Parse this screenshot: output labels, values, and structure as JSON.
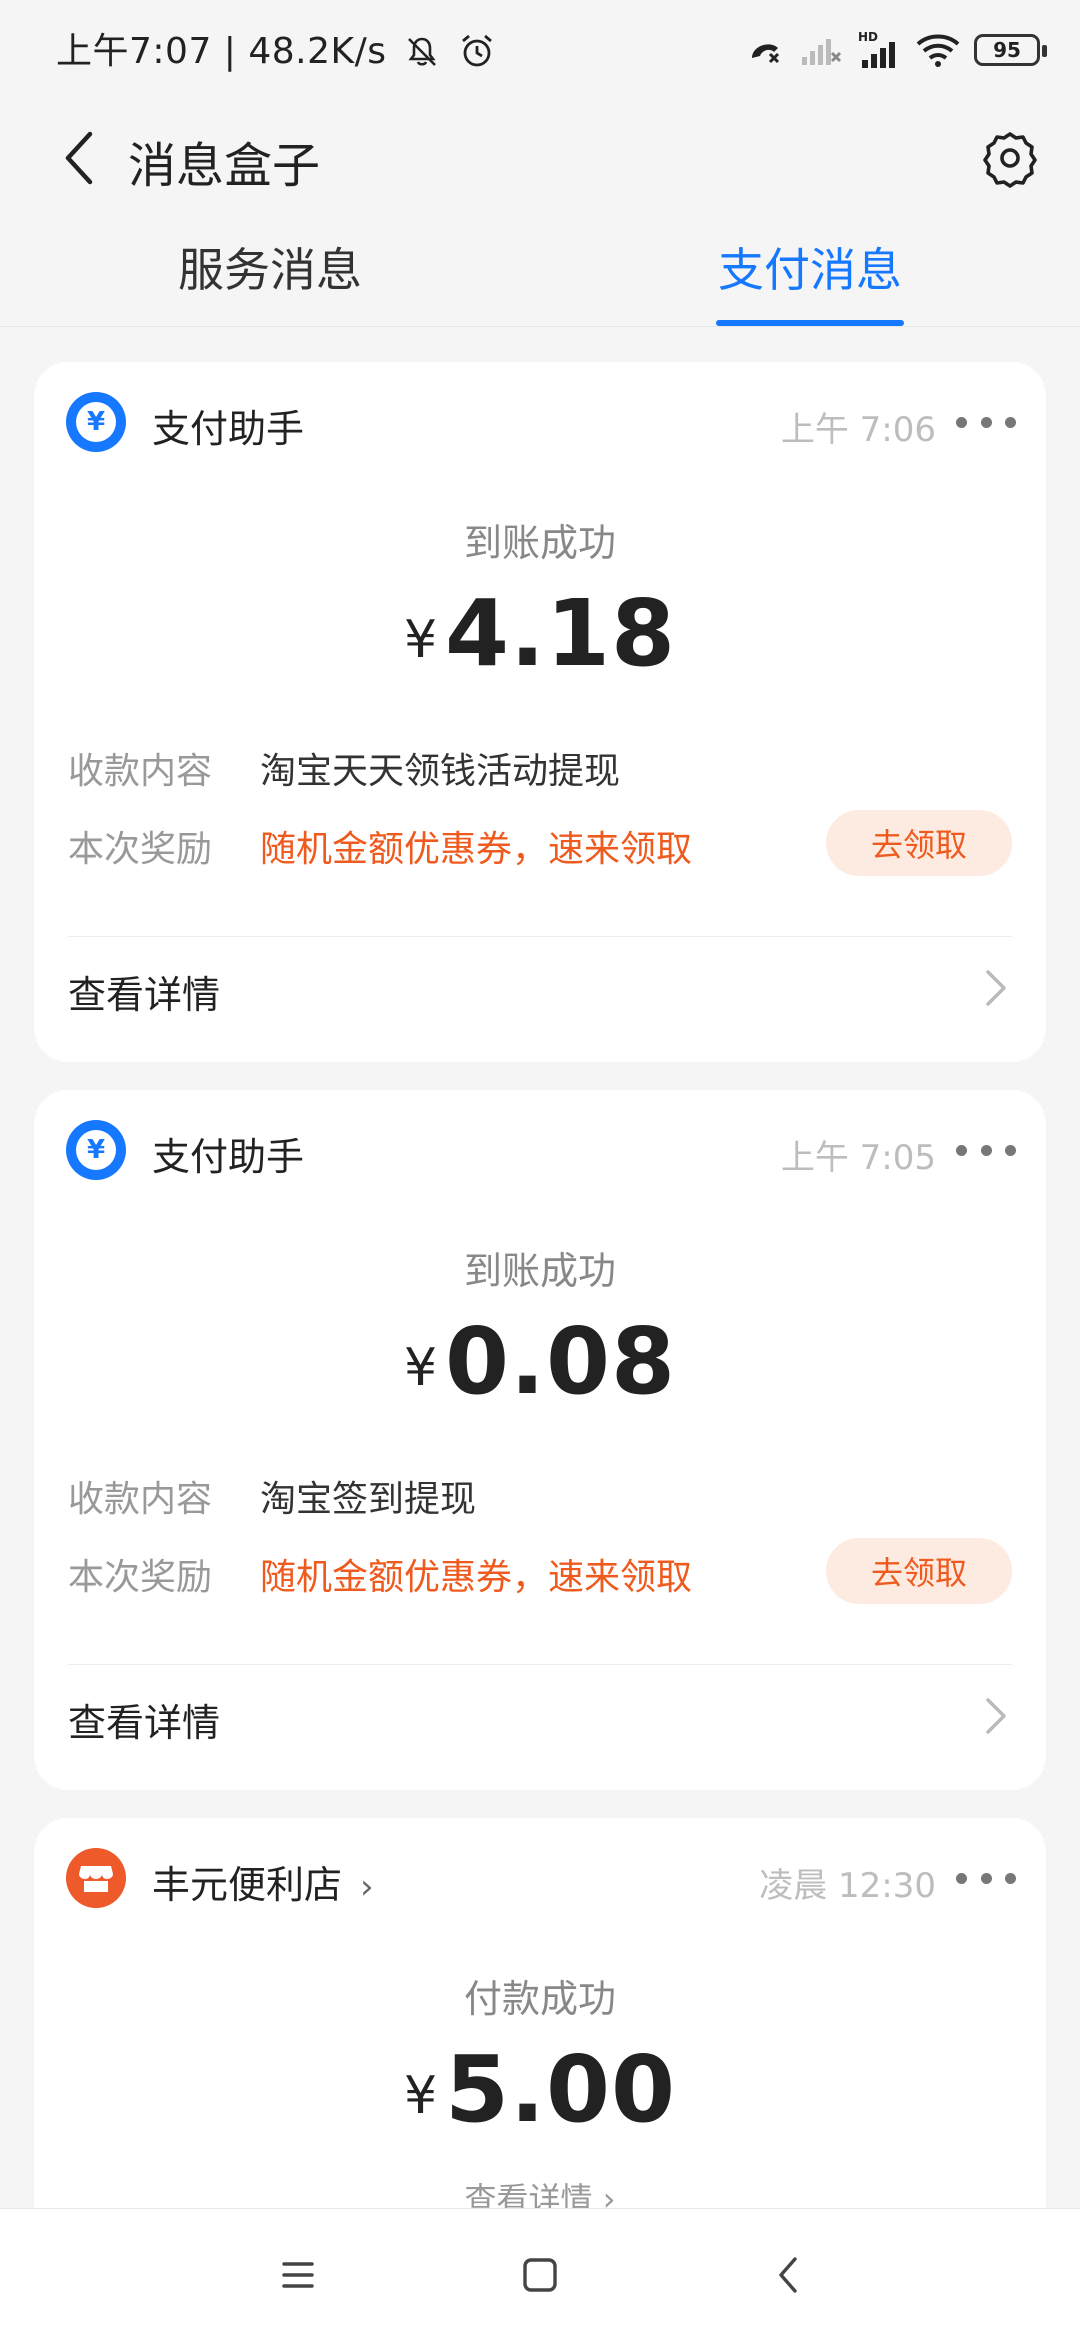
{
  "status_bar": {
    "left_text": "上午7:07 | 48.2K/s",
    "battery": "95"
  },
  "header": {
    "title": "消息盒子"
  },
  "tabs": [
    {
      "label": "服务消息",
      "active": false
    },
    {
      "label": "支付消息",
      "active": true
    }
  ],
  "messages": [
    {
      "sender": "支付助手",
      "time": "上午 7:06",
      "status": "到账成功",
      "currency": "¥",
      "amount": "4.18",
      "content_label": "收款内容",
      "content_value": "淘宝天天领钱活动提现",
      "reward_label": "本次奖励",
      "reward_value": "随机金额优惠券，速来领取",
      "claim_label": "去领取",
      "detail_label": "查看详情"
    },
    {
      "sender": "支付助手",
      "time": "上午 7:05",
      "status": "到账成功",
      "currency": "¥",
      "amount": "0.08",
      "content_label": "收款内容",
      "content_value": "淘宝签到提现",
      "reward_label": "本次奖励",
      "reward_value": "随机金额优惠券，速来领取",
      "claim_label": "去领取",
      "detail_label": "查看详情"
    },
    {
      "sender": "丰元便利店",
      "time": "凌晨 12:30",
      "status": "付款成功",
      "currency": "¥",
      "amount": "5.00",
      "detail_label": "查看详情"
    }
  ],
  "colors": {
    "accent_blue": "#1677ff",
    "reward_orange": "#ef5b1f",
    "claim_bg": "#fdebe2",
    "store_icon": "#ee5a2a"
  },
  "icons": {
    "back": "back-arrow-icon",
    "settings": "gear-icon",
    "pay_assistant": "yuan-icon",
    "store": "store-icon",
    "more": "more-dots-icon",
    "chevron": "chevron-right-icon",
    "nav_menu": "menu-icon",
    "nav_home": "home-square-icon",
    "nav_back": "nav-back-icon"
  }
}
